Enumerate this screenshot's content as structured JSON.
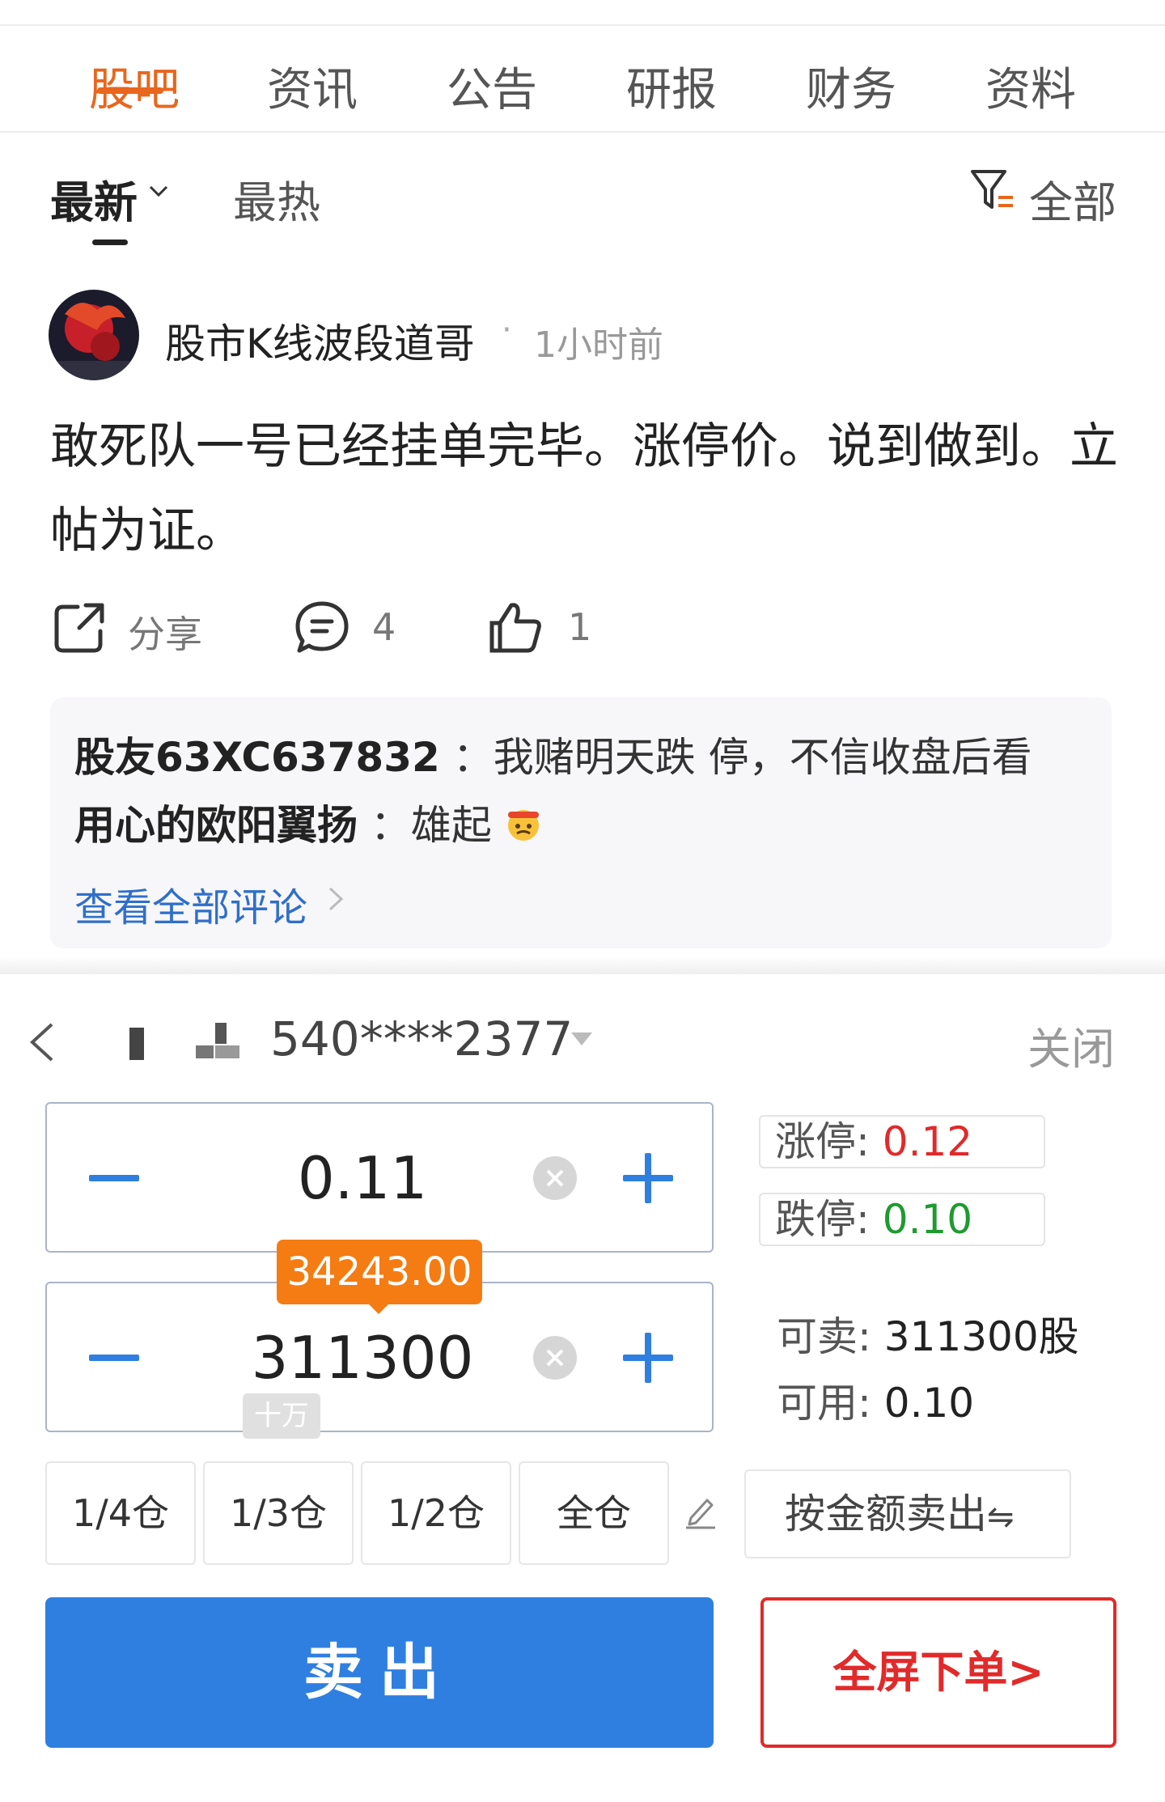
{
  "colors": {
    "accent": "#e8661d",
    "buy_sell_blue": "#2f7fe0",
    "up_red": "#e12a2a",
    "down_green": "#1f9a2f",
    "link_blue": "#2f6fc9"
  },
  "tabs": [
    {
      "label": "股吧",
      "active": true
    },
    {
      "label": "资讯"
    },
    {
      "label": "公告"
    },
    {
      "label": "研报"
    },
    {
      "label": "财务"
    },
    {
      "label": "资料"
    }
  ],
  "sort": {
    "latest": "最新",
    "hot": "最热",
    "filter_label": "全部"
  },
  "post": {
    "author": "股市K线波段道哥",
    "dot": "·",
    "time": "1小时前",
    "content": "敢死队一号已经挂单完毕。涨停价。说到做到。立帖为证。",
    "share_label": "分享",
    "comment_count": "4",
    "like_count": "1"
  },
  "comments": [
    {
      "user": "股友63XC637832",
      "sep": "：",
      "text": "我赌明天跌 停，不信收盘后看"
    },
    {
      "user": "用心的欧阳翼扬",
      "sep": "：",
      "text": "雄起"
    }
  ],
  "view_all": "查看全部评论",
  "trade": {
    "account": "540****2377",
    "close": "关闭",
    "price": "0.11",
    "quantity": "311300",
    "amount_tip": "34243.00",
    "unit_hint": "十万",
    "limit_up_label": "涨停:",
    "limit_up_value": "0.12",
    "limit_down_label": "跌停:",
    "limit_down_value": "0.10",
    "sellable_label": "可卖:",
    "sellable_value": "311300股",
    "available_label": "可用:",
    "available_value": "0.10",
    "positions": [
      "1/4仓",
      "1/3仓",
      "1/2仓",
      "全仓"
    ],
    "amount_sell": "按金额卖出",
    "amount_sell_suffix": "⇋",
    "sell": "卖出",
    "fullscreen": "全屏下单>"
  }
}
